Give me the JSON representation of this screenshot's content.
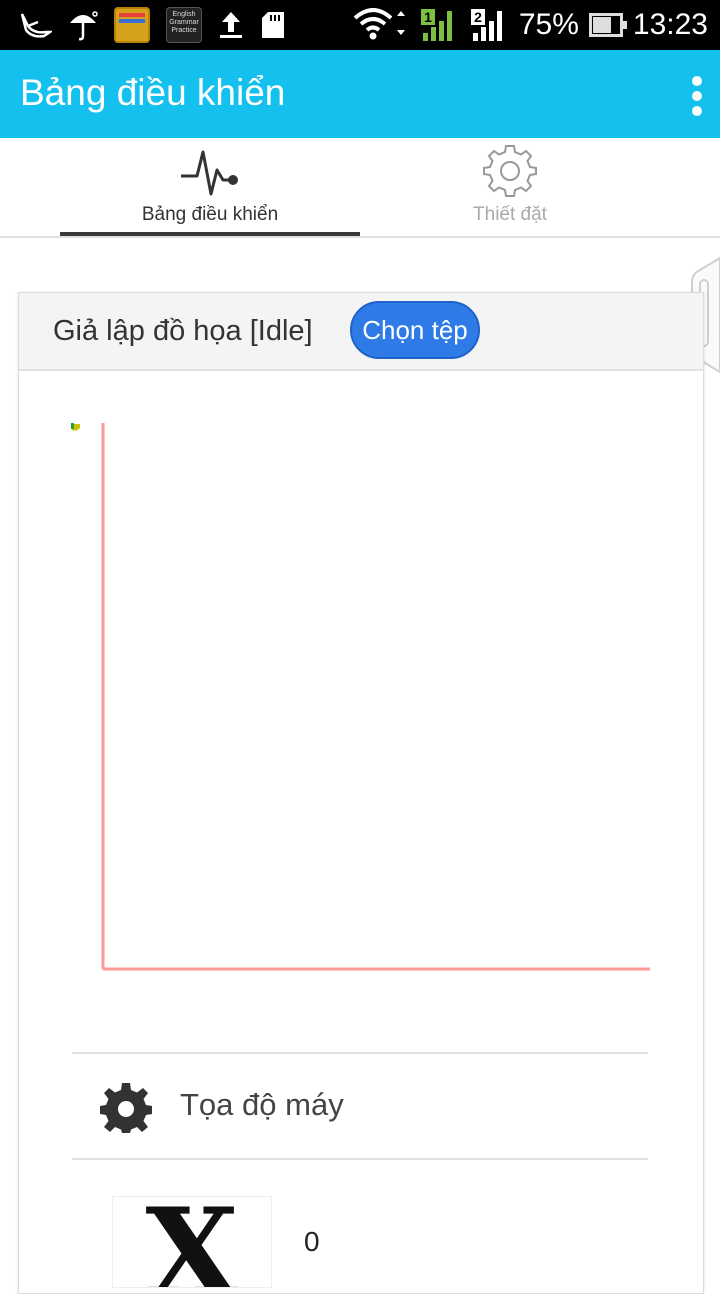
{
  "status_bar": {
    "battery": "75%",
    "time": "13:23",
    "sim1": "1",
    "sim2": "2",
    "notif_app_text": "English Grammar Practice",
    "icons": [
      "bird-icon",
      "umbrella-icon",
      "folder-app-icon",
      "english-grammar-app-icon",
      "upload-icon",
      "sd-card-icon",
      "wifi-icon",
      "signal-sim1-icon",
      "signal-sim2-icon",
      "battery-icon"
    ]
  },
  "appbar": {
    "title": "Bảng điều khiển",
    "color": "#14c0ee"
  },
  "tabs": [
    {
      "label": "Bảng điều khiển",
      "icon": "pulse-icon",
      "active": true
    },
    {
      "label": "Thiết đặt",
      "icon": "gear-icon",
      "active": false
    }
  ],
  "card": {
    "title": "Giả lập đồ họa [Idle]",
    "choose_button": "Chọn tệp",
    "button_color": "#2e7be8",
    "axis_color": "#ff9a9a"
  },
  "machine": {
    "label": "Tọa độ máy",
    "x_axis_glyph": "X",
    "x_value": "0"
  }
}
